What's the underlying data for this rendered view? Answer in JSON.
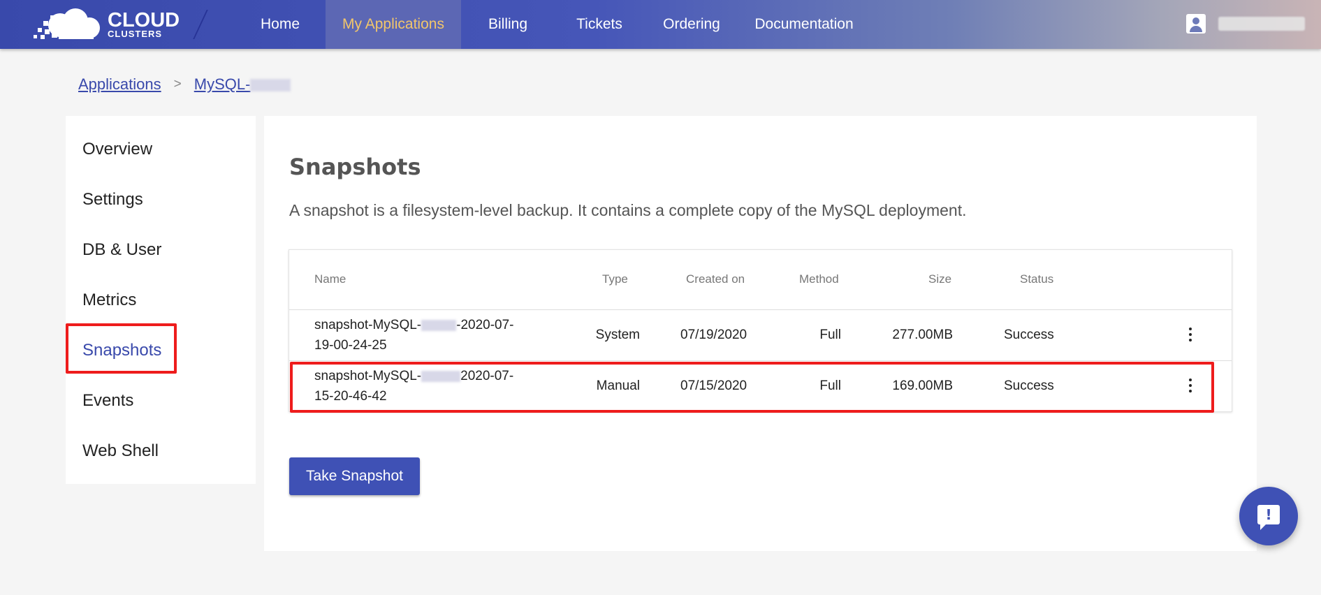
{
  "logo": {
    "line1": "CLOUD",
    "line2": "CLUSTERS"
  },
  "nav": {
    "items": [
      {
        "label": "Home"
      },
      {
        "label": "My Applications",
        "active": true
      },
      {
        "label": "Billing"
      },
      {
        "label": "Tickets"
      },
      {
        "label": "Ordering"
      },
      {
        "label": "Documentation"
      }
    ],
    "active_color": "#f2c66b"
  },
  "breadcrumb": {
    "root": "Applications",
    "separator": ">",
    "current": "MySQL-"
  },
  "sidebar": {
    "items": [
      {
        "label": "Overview"
      },
      {
        "label": "Settings"
      },
      {
        "label": "DB & User"
      },
      {
        "label": "Metrics"
      },
      {
        "label": "Snapshots",
        "active": true
      },
      {
        "label": "Events"
      },
      {
        "label": "Web Shell"
      }
    ]
  },
  "main": {
    "title": "Snapshots",
    "description": "A snapshot is a filesystem-level backup. It contains a complete copy of the MySQL deployment.",
    "table": {
      "headers": {
        "name": "Name",
        "type": "Type",
        "created": "Created on",
        "method": "Method",
        "size": "Size",
        "status": "Status"
      },
      "rows": [
        {
          "name_l1a": "snapshot-MySQL-",
          "name_l1b": "-2020-07-",
          "name_l2": "19-00-24-25",
          "type": "System",
          "created": "07/19/2020",
          "method": "Full",
          "size": "277.00MB",
          "status": "Success"
        },
        {
          "name_l1a": "snapshot-MySQL-",
          "name_l1b": "2020-07-",
          "name_l2": "15-20-46-42",
          "type": "Manual",
          "created": "07/15/2020",
          "method": "Full",
          "size": "169.00MB",
          "status": "Success"
        }
      ]
    },
    "take_button": "Take Snapshot"
  },
  "colors": {
    "primary": "#3f51b5",
    "highlight": "#ee1c1c"
  },
  "icons": {
    "user": "account-box-icon",
    "row_menu": "more-vert-icon",
    "feedback": "feedback-icon"
  }
}
